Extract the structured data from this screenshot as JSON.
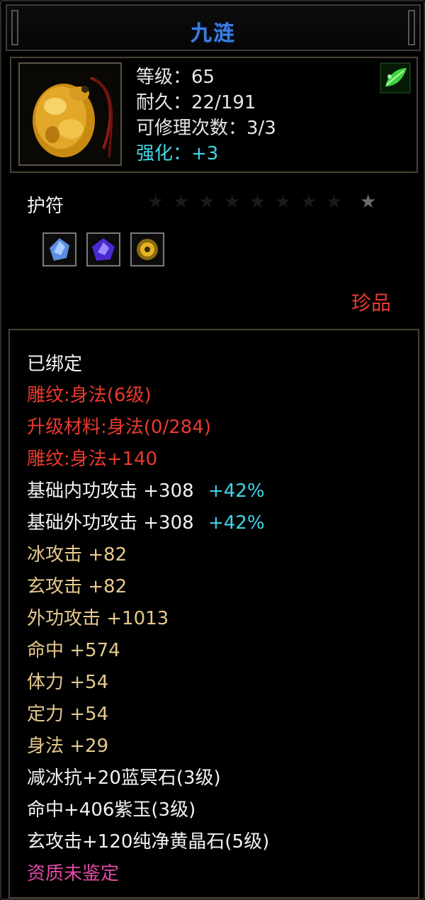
{
  "item": {
    "name": "九涟",
    "level_line": "等级：65",
    "durability_line": "耐久：22/191",
    "repair_line": "可修理次数：3/3",
    "enhance_line": "强化：+3",
    "type": "护符",
    "rarity": "珍品",
    "star_count": 9,
    "active_stars": 1
  },
  "gems": [
    {
      "name": "ice-gem-icon",
      "color": "#6aa8ff"
    },
    {
      "name": "purple-jade-gem-icon",
      "color": "#6a4cff"
    },
    {
      "name": "yellow-crystal-gem-icon",
      "color": "#e0b020"
    }
  ],
  "attributes": {
    "bound": "已绑定",
    "carve_1": "雕纹:身法(6级)",
    "upgrade_material": "升级材料:身法(0/284)",
    "carve_2": "雕纹:身法+140",
    "base_inner_attack": {
      "label": "基础内功攻击  +308",
      "pct": "+42%"
    },
    "base_outer_attack": {
      "label": "基础外功攻击  +308",
      "pct": "+42%"
    },
    "ice_attack": "冰攻击  +82",
    "xuan_attack": "玄攻击  +82",
    "outer_attack": "外功攻击  +1013",
    "hit": "命中  +574",
    "stamina": "体力  +54",
    "focus": "定力  +54",
    "agility": "身法  +29",
    "gem_line_1": "减冰抗+20蓝冥石(3级)",
    "gem_line_2": "命中+406紫玉(3级)",
    "gem_line_3": "玄攻击+120纯净黄晶石(5级)",
    "quality": "资质未鉴定"
  }
}
